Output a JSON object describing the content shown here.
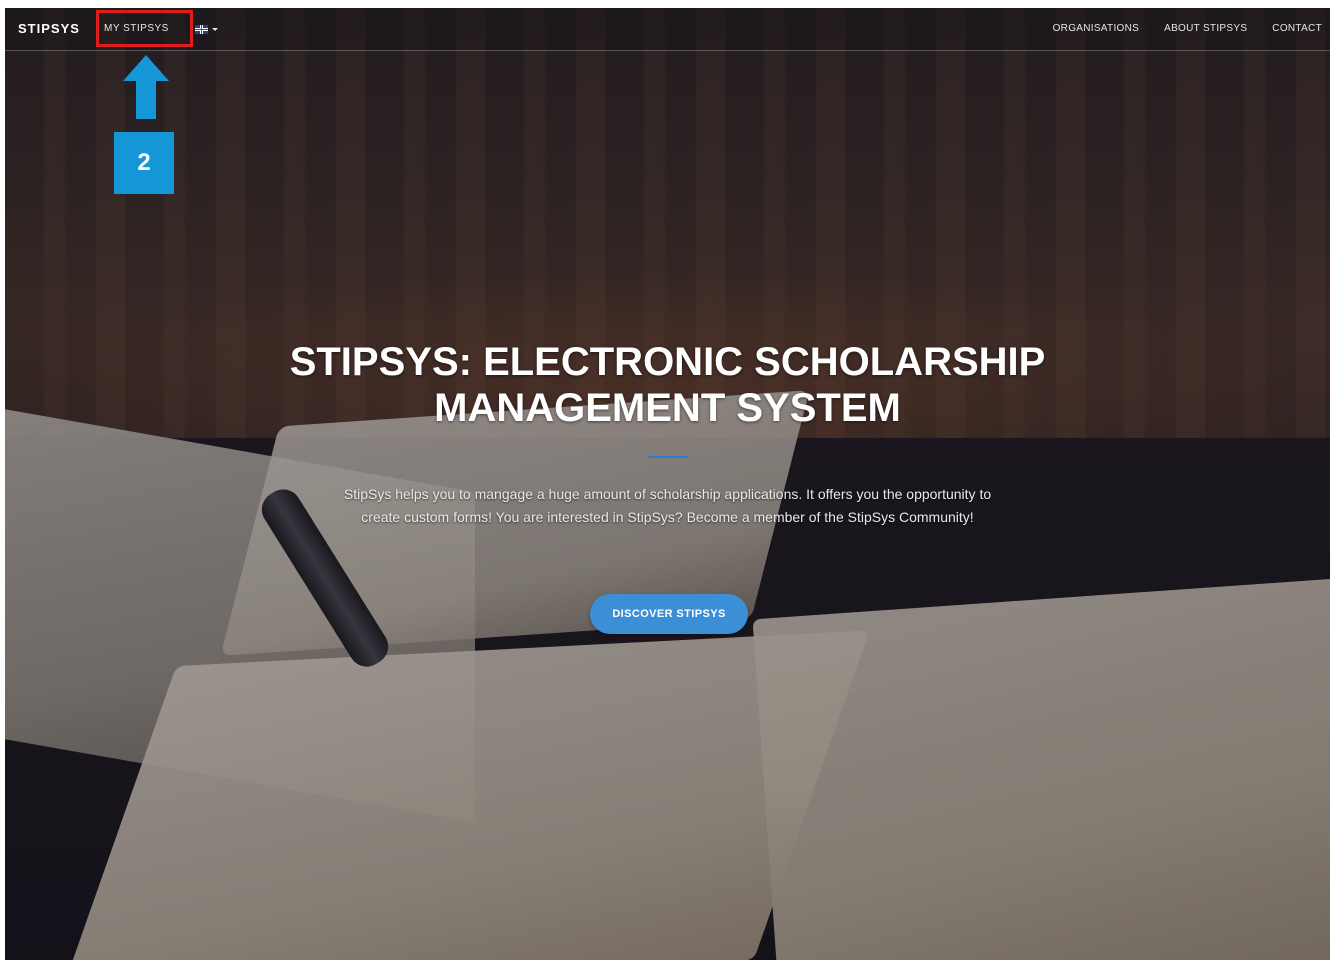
{
  "navbar": {
    "brand": "STIPSYS",
    "my_stipsys": "MY STIPSYS",
    "language_flag": "uk-flag-icon",
    "right_links": [
      "ORGANISATIONS",
      "ABOUT STIPSYS",
      "CONTACT"
    ]
  },
  "annotation": {
    "step_number": "2",
    "arrow_icon": "arrow-up-icon",
    "arrow_color": "#1596d6",
    "highlight_color": "#e01d1d"
  },
  "hero": {
    "title_line1": "STIPSYS: ELECTRONIC SCHOLARSHIP",
    "title_line2": "MANAGEMENT SYSTEM",
    "description": "StipSys helps you to mangage a huge amount of scholarship applications. It offers you the opportunity to create custom forms! You are interested in StipSys? Become a member of the StipSys Community!",
    "button_label": "DISCOVER STIPSYS",
    "accent_color": "#3a8fd6"
  }
}
